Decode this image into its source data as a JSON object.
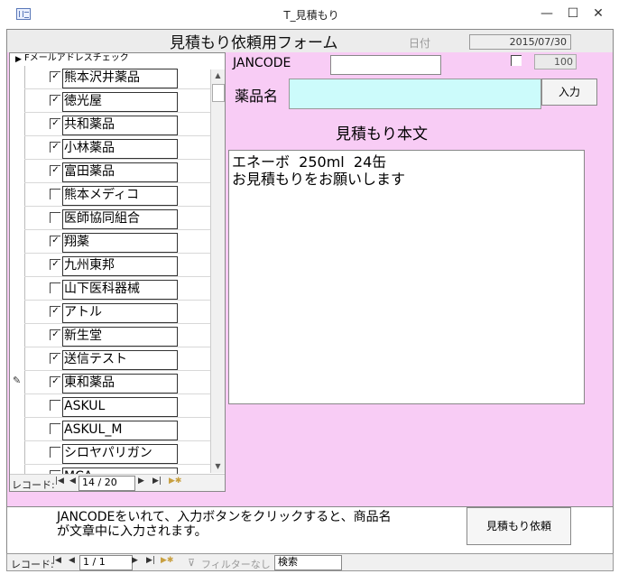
{
  "window": {
    "title": "T_見積もり",
    "minimize": "—",
    "maximize": "☐",
    "close": "✕"
  },
  "header": {
    "form_title": "見積もり依頼用フォーム",
    "date_label": "日付",
    "date_value": "2015/07/30"
  },
  "subform": {
    "column_header": "Fメールアドレスチェック",
    "rows": [
      {
        "name": "熊本沢井薬品",
        "checked": true
      },
      {
        "name": "徳光屋",
        "checked": true
      },
      {
        "name": "共和薬品",
        "checked": true
      },
      {
        "name": "小林薬品",
        "checked": true
      },
      {
        "name": "富田薬品",
        "checked": true
      },
      {
        "name": "熊本メディコ",
        "checked": false
      },
      {
        "name": "医師協同組合",
        "checked": false
      },
      {
        "name": "翔薬",
        "checked": true
      },
      {
        "name": "九州東邦",
        "checked": true
      },
      {
        "name": "山下医科器械",
        "checked": false
      },
      {
        "name": "アトル",
        "checked": true
      },
      {
        "name": "新生堂",
        "checked": true
      },
      {
        "name": "送信テスト",
        "checked": true
      },
      {
        "name": "東和薬品",
        "checked": true,
        "editing": true
      },
      {
        "name": "ASKUL",
        "checked": false
      },
      {
        "name": "ASKUL_M",
        "checked": false
      },
      {
        "name": "シロヤパリガン",
        "checked": false
      },
      {
        "name": "MCA",
        "checked": false
      }
    ],
    "nav": {
      "label": "レコード:",
      "current": "14 / 20"
    }
  },
  "form": {
    "jancode_label": "JANCODE",
    "jancode_value": "",
    "qty_value": "100",
    "drug_label": "薬品名",
    "drug_value": "",
    "input_button": "入力",
    "body_label": "見積もり本文",
    "body_text": "エネーボ  250ml  24缶\nお見積もりをお願いします"
  },
  "footer": {
    "note": "JANCODEをいれて、入力ボタンをクリックすると、商品名\nが文章中に入力されます。",
    "request_button": "見積もり依頼"
  },
  "bottom_nav": {
    "label": "レコード:",
    "current": "1 / 1",
    "filter": "フィルターなし",
    "search": "検索"
  }
}
